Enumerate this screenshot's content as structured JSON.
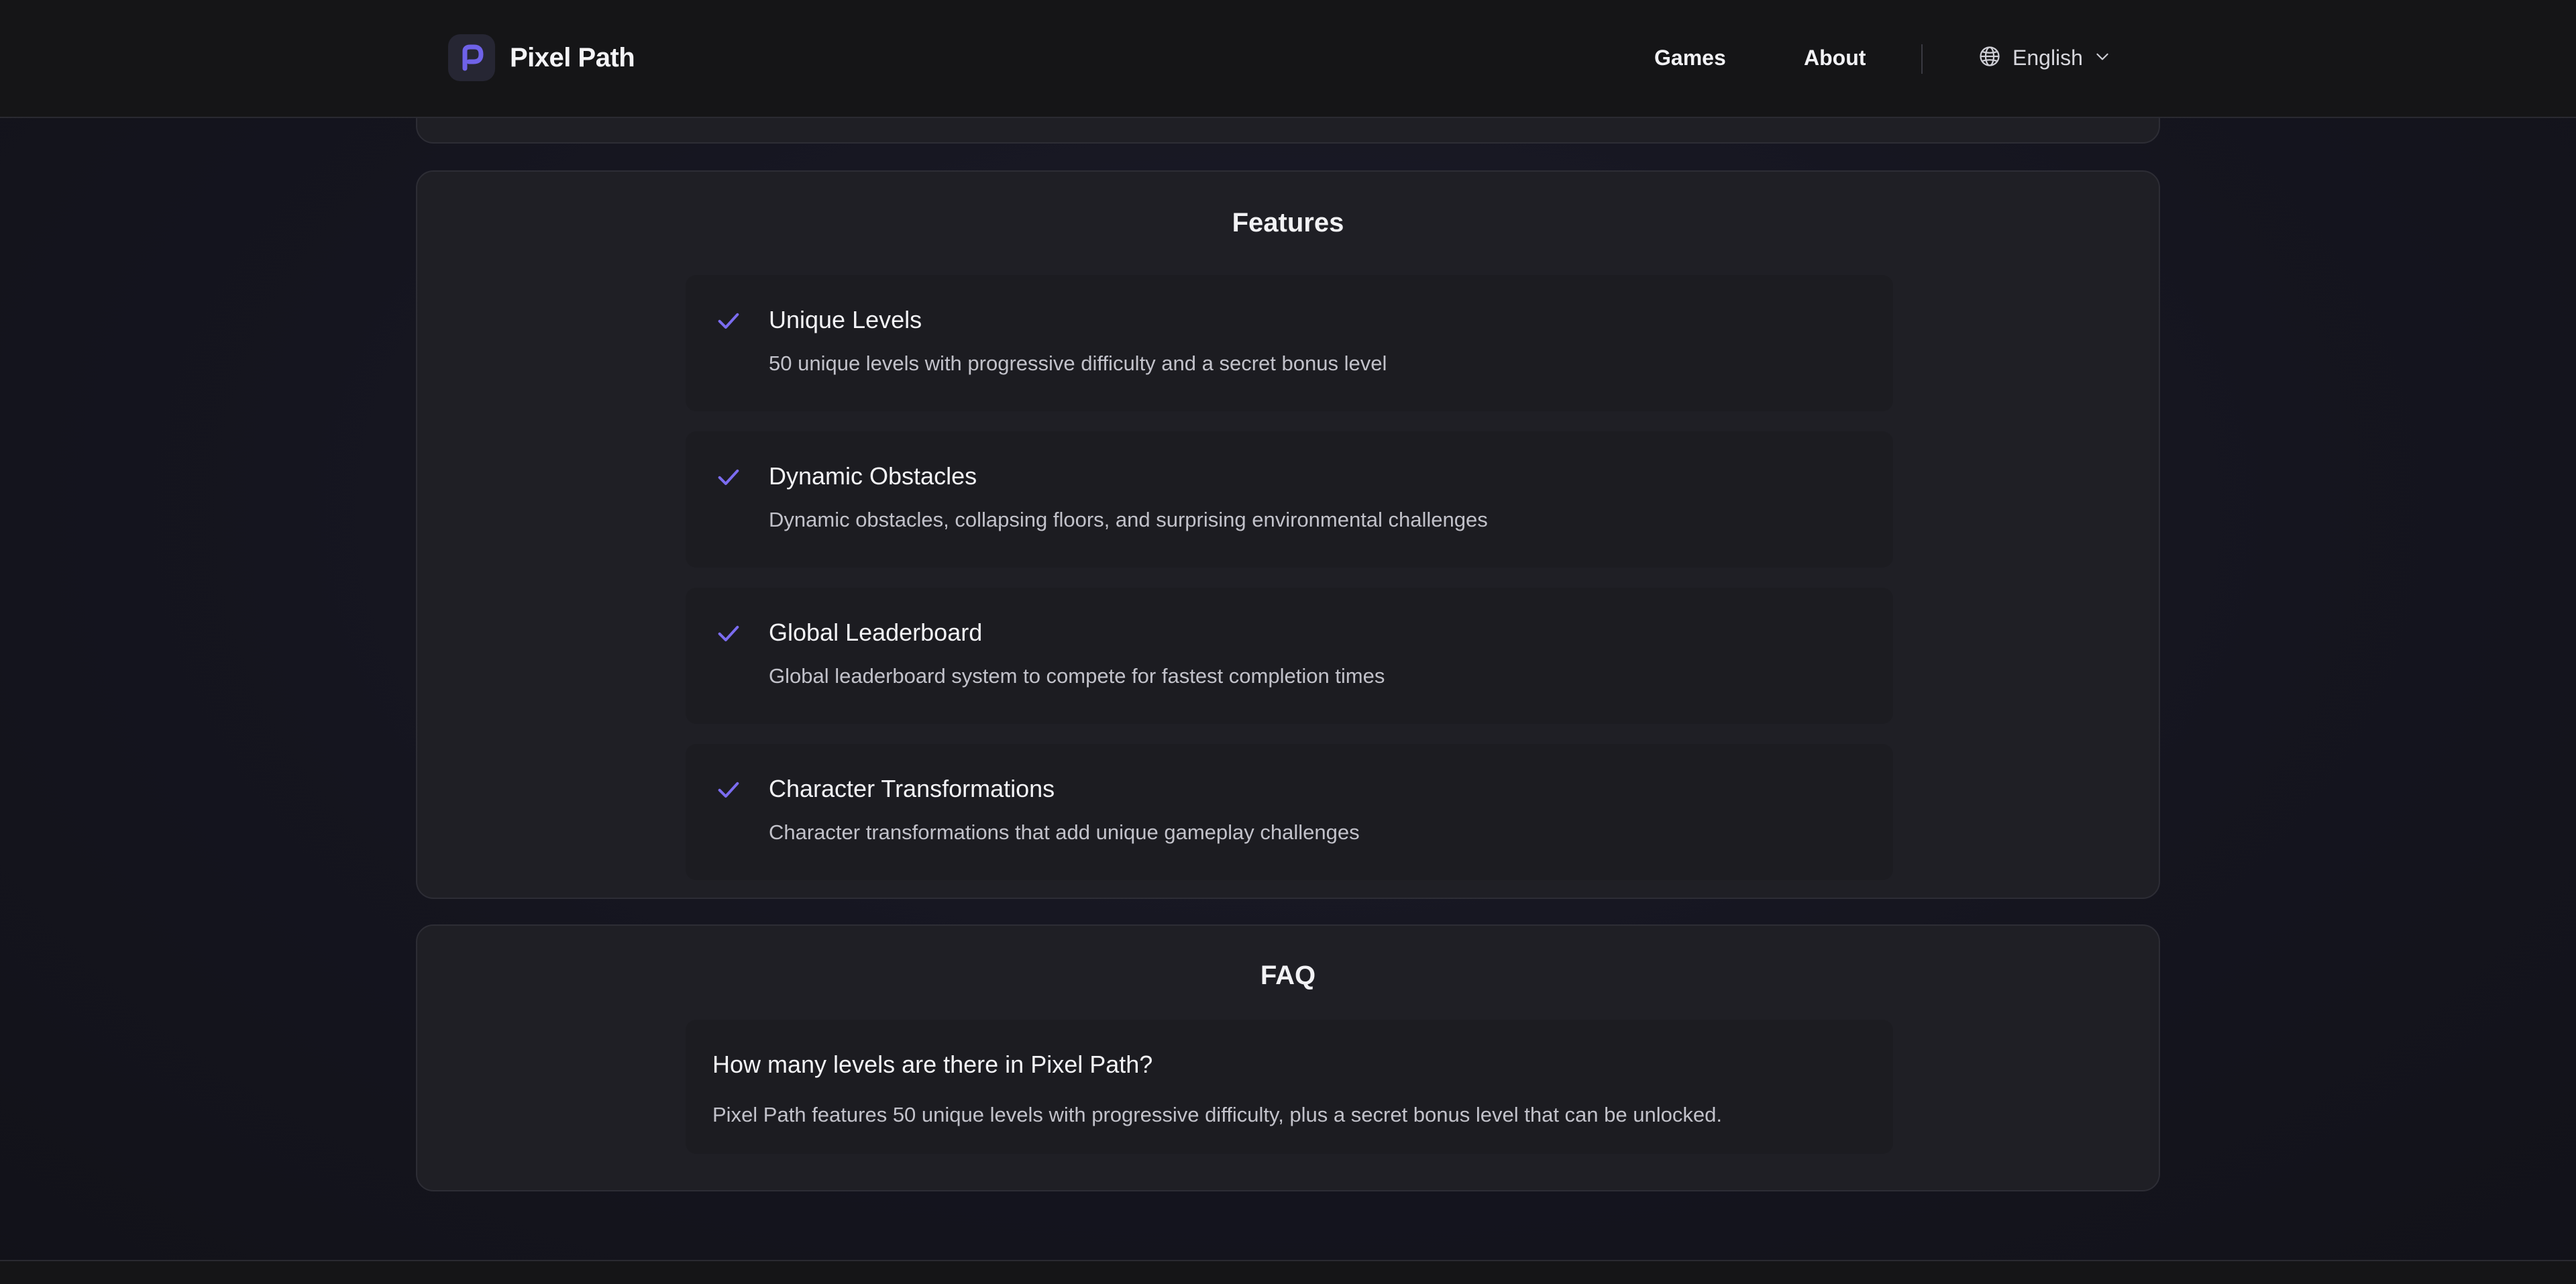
{
  "header": {
    "brand_name": "Pixel Path",
    "nav": {
      "games": "Games",
      "about": "About"
    },
    "language": "English"
  },
  "features": {
    "title": "Features",
    "items": [
      {
        "title": "Unique Levels",
        "description": "50 unique levels with progressive difficulty and a secret bonus level"
      },
      {
        "title": "Dynamic Obstacles",
        "description": "Dynamic obstacles, collapsing floors, and surprising environmental challenges"
      },
      {
        "title": "Global Leaderboard",
        "description": "Global leaderboard system to compete for fastest completion times"
      },
      {
        "title": "Character Transformations",
        "description": "Character transformations that add unique gameplay challenges"
      }
    ]
  },
  "faq": {
    "title": "FAQ",
    "items": [
      {
        "question": "How many levels are there in Pixel Path?",
        "answer": "Pixel Path features 50 unique levels with progressive difficulty, plus a secret bonus level that can be unlocked."
      }
    ]
  },
  "colors": {
    "accent": "#7b6cf0",
    "background": "#16161f",
    "card": "#1f1f25",
    "item": "#1c1c21"
  }
}
